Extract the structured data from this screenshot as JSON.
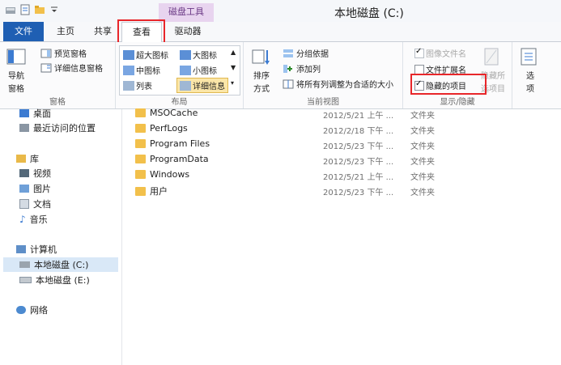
{
  "window": {
    "title": "本地磁盘 (C:)",
    "context_tab_group": "磁盘工具"
  },
  "tabs": [
    {
      "label": "文件"
    },
    {
      "label": "主页"
    },
    {
      "label": "共享"
    },
    {
      "label": "查看"
    },
    {
      "label": "驱动器"
    }
  ],
  "ribbon": {
    "panes": {
      "nav_pane": "导航",
      "nav_pane2": "窗格",
      "preview": "预览窗格",
      "details": "详细信息窗格",
      "label": "窗格"
    },
    "layout": {
      "items": [
        "超大图标",
        "大图标",
        "中图标",
        "小图标",
        "列表",
        "详细信息"
      ],
      "label": "布局"
    },
    "current_view": {
      "sort": "排序",
      "sort2": "方式",
      "group_by": "分组依据",
      "add_column": "添加列",
      "fit_columns": "将所有列调整为合适的大小",
      "label": "当前视图"
    },
    "show_hide": {
      "item_checkbox": "图像文件名",
      "extensions": "文件扩展名",
      "hidden_items": "隐藏的项目",
      "hide_selected": "隐藏所",
      "hide_selected2": "选项目",
      "label": "显示/隐藏"
    },
    "options": {
      "label": "选",
      "label2": "项"
    }
  },
  "navigation": {
    "desktop": "桌面",
    "recent": "最近访问的位置",
    "libraries": "库",
    "videos": "视频",
    "pictures": "图片",
    "documents": "文档",
    "music": "音乐",
    "computer": "计算机",
    "drive_c": "本地磁盘 (C:)",
    "drive_e": "本地磁盘 (E:)",
    "network": "网络"
  },
  "files": [
    {
      "name": "MSOCache",
      "date": "2012/5/21 上午 ...",
      "type": "文件夹"
    },
    {
      "name": "PerfLogs",
      "date": "2012/2/18 下午 ...",
      "type": "文件夹"
    },
    {
      "name": "Program Files",
      "date": "2012/5/23 下午 ...",
      "type": "文件夹"
    },
    {
      "name": "ProgramData",
      "date": "2012/5/23 下午 ...",
      "type": "文件夹"
    },
    {
      "name": "Windows",
      "date": "2012/5/21 上午 ...",
      "type": "文件夹"
    },
    {
      "name": "用户",
      "date": "2012/5/23 下午 ...",
      "type": "文件夹"
    }
  ],
  "colors": {
    "file_tab": "#1f5fb3",
    "highlight_box": "#e8262a",
    "context_tab": "#e8d4ef"
  }
}
